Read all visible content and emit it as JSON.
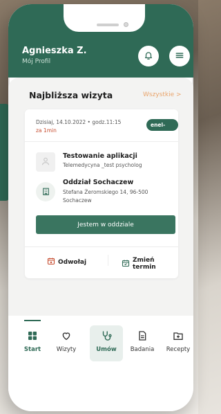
{
  "header": {
    "user_name": "Agnieszka Z.",
    "user_sub": "Mój Profil"
  },
  "section": {
    "title": "Najbliższa wizyta",
    "link": "Wszystkie >"
  },
  "visit": {
    "date": "Dzisiaj, 14.10.2022 • godz.11:15",
    "time_left": "za 1min",
    "badge": "enel-med",
    "doctor_name": "Testowanie aplikacji",
    "doctor_spec": "Telemedycyna _test psycholog",
    "clinic_name": "Oddział Sochaczew",
    "clinic_address": "Stefana Żeromskiego 14, 96-500 Sochaczew",
    "cta": "Jestem w oddziale",
    "cancel": "Odwołaj",
    "change": "Zmień termin"
  },
  "nav": {
    "items": [
      {
        "label": "Start",
        "icon": "grid-icon"
      },
      {
        "label": "Wizyty",
        "icon": "heart-icon"
      },
      {
        "label": "Umów",
        "icon": "stethoscope-icon"
      },
      {
        "label": "Badania",
        "icon": "document-icon"
      },
      {
        "label": "Recepty",
        "icon": "folder-plus-icon"
      }
    ]
  },
  "colors": {
    "brand": "#2f6a56",
    "accent": "#e9a46b",
    "alert": "#c64b2e"
  }
}
